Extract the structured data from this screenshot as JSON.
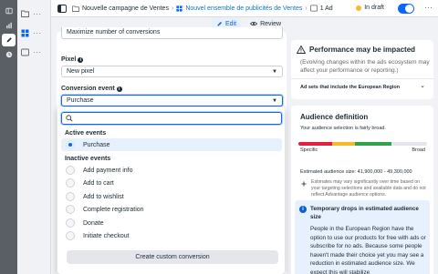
{
  "rail": {
    "icons": [
      "sidebar-toggle-icon",
      "chart-icon",
      "pencil-icon",
      "clock-icon"
    ]
  },
  "topbar": {
    "campaign": "Nouvelle campagne de Ventes",
    "adset": "Nouvel ensemble de publicités de Ventes",
    "ad": "1 Ad",
    "status": "In draft",
    "more": "···"
  },
  "mode": {
    "edit_label": "Edit",
    "review_label": "Review"
  },
  "editor": {
    "goal_value": "Maximize number of conversions",
    "pixel_label": "Pixel",
    "pixel_value": "New pixel",
    "conversion_label": "Conversion event",
    "conversion_value": "Purchase"
  },
  "dropdown": {
    "search_placeholder": "",
    "active_heading": "Active events",
    "active_items": [
      "Purchase"
    ],
    "inactive_heading": "Inactive events",
    "inactive_items": [
      "Add payment info",
      "Add to cart",
      "Add to wishlist",
      "Complete registration",
      "Donate",
      "Initiate checkout"
    ],
    "create_label": "Create custom conversion"
  },
  "performance": {
    "title": "Performance may be impacted",
    "body": "(Evolving changes within the ads ecosystem may affect your performance or reporting.)",
    "link": "Ad sets that include the European Region"
  },
  "audience": {
    "title": "Audience definition",
    "subtitle": "Your audience selection is fairly broad.",
    "specific": "Specific",
    "broad": "Broad",
    "breadth": 0.72,
    "size": "Estimated audience size: 41,900,000 - 49,300,000",
    "note": "Estimates may vary significantly over time based on your targeting selections and available data and do not reflect Advantage audience options.",
    "warn_title": "Temporary drops in estimated audience size",
    "warn_body": "People in the European Region have the option to use our products for free with ads or subscribe for no ads. Because some people haven't made their choice yet you may see a reduction in estimated audience size. We expect this will stabilize"
  },
  "colors": {
    "accent": "#0866ff",
    "draft": "#f7b928",
    "meter_red": "#e41e3f",
    "meter_yellow": "#f7b928",
    "meter_green": "#31a24c"
  }
}
